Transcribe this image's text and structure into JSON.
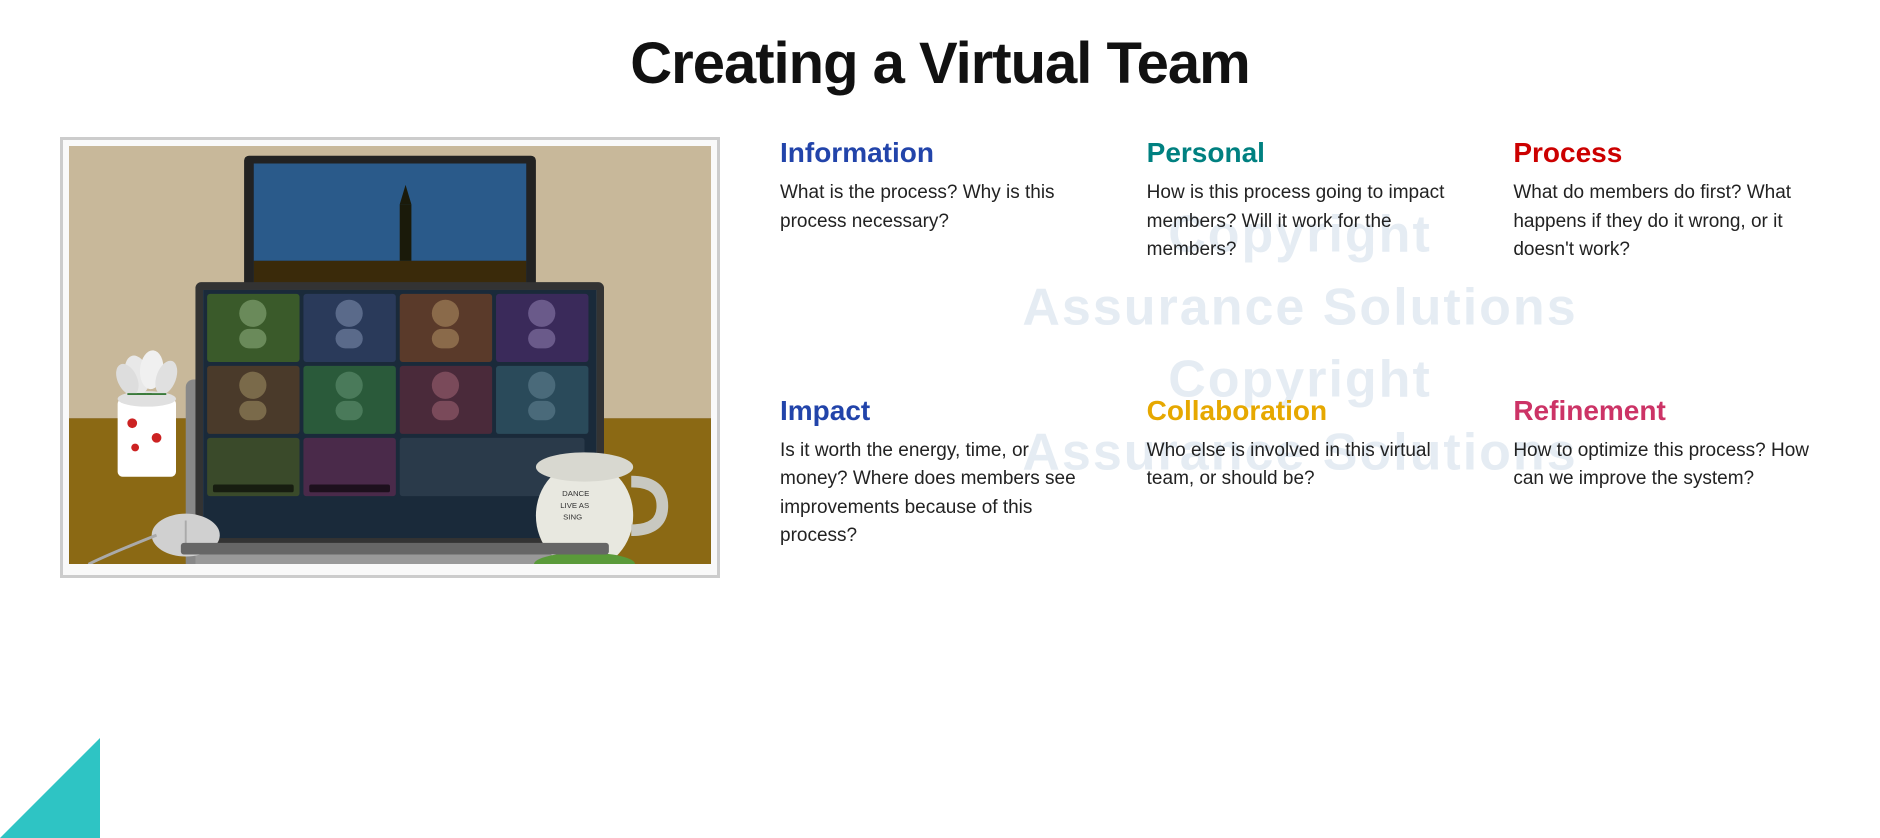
{
  "page": {
    "title": "Creating a Virtual Team"
  },
  "watermark_lines": [
    "Copyright",
    "Assurance Solutions",
    "Copyright",
    "Assurance Solutions"
  ],
  "categories": [
    {
      "id": "information",
      "label": "Information",
      "color_class": "information",
      "text": "What is the process? Why is this process necessary?"
    },
    {
      "id": "personal",
      "label": "Personal",
      "color_class": "personal",
      "text": "How is this process going to impact members? Will it work for the members?"
    },
    {
      "id": "process",
      "label": "Process",
      "color_class": "process",
      "text": "What do members do first? What happens if they do it wrong, or it doesn't work?"
    },
    {
      "id": "impact",
      "label": "Impact",
      "color_class": "impact",
      "text": "Is it worth the energy, time, or money? Where does members see improvements because of this process?"
    },
    {
      "id": "collaboration",
      "label": "Collaboration",
      "color_class": "collaboration",
      "text": "Who else is involved in this virtual team, or should be?"
    },
    {
      "id": "refinement",
      "label": "Refinement",
      "color_class": "refinement",
      "text": "How to optimize this process? How can we improve the system?"
    }
  ]
}
